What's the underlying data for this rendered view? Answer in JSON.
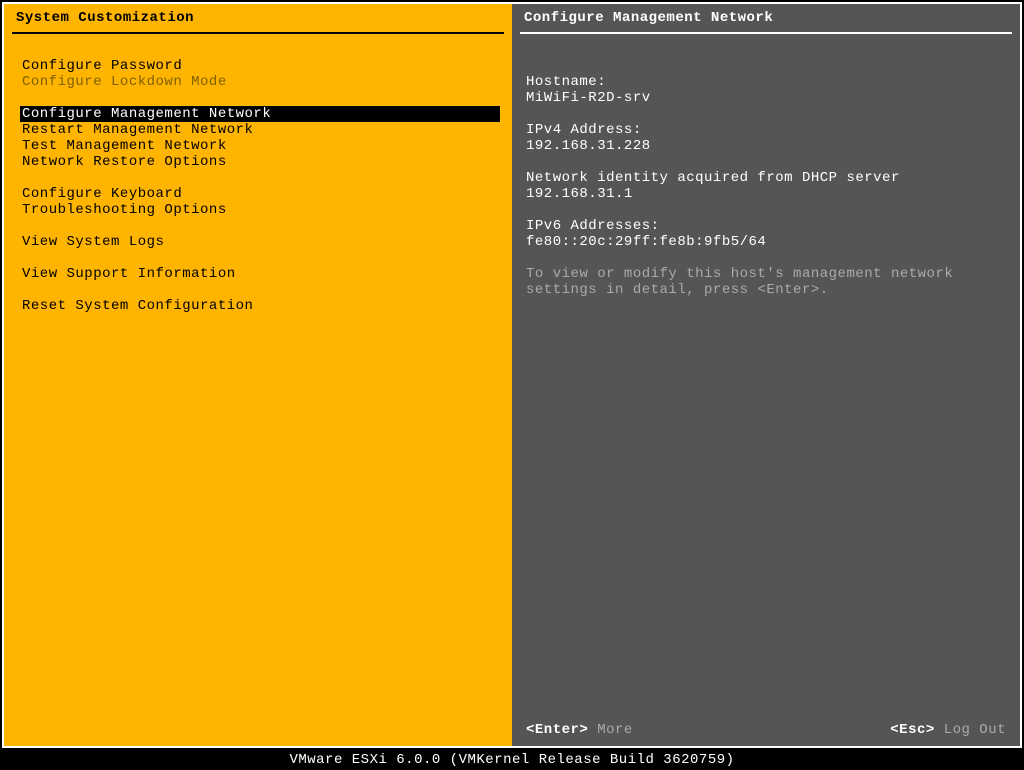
{
  "left": {
    "title": "System Customization",
    "groups": [
      [
        {
          "label": "Configure Password",
          "state": "normal"
        },
        {
          "label": "Configure Lockdown Mode",
          "state": "disabled"
        }
      ],
      [
        {
          "label": "Configure Management Network",
          "state": "selected"
        },
        {
          "label": "Restart Management Network",
          "state": "normal"
        },
        {
          "label": "Test Management Network",
          "state": "normal"
        },
        {
          "label": "Network Restore Options",
          "state": "normal"
        }
      ],
      [
        {
          "label": "Configure Keyboard",
          "state": "normal"
        },
        {
          "label": "Troubleshooting Options",
          "state": "normal"
        }
      ],
      [
        {
          "label": "View System Logs",
          "state": "normal"
        }
      ],
      [
        {
          "label": "View Support Information",
          "state": "normal"
        }
      ],
      [
        {
          "label": "Reset System Configuration",
          "state": "normal"
        }
      ]
    ]
  },
  "right": {
    "title": "Configure Management Network",
    "hostname_label": "Hostname:",
    "hostname_value": "MiWiFi-R2D-srv",
    "ipv4_label": "IPv4 Address:",
    "ipv4_value": "192.168.31.228",
    "dhcp_line": "Network identity acquired from DHCP server 192.168.31.1",
    "ipv6_label": "IPv6 Addresses:",
    "ipv6_value": "fe80::20c:29ff:fe8b:9fb5/64",
    "help_text": "To view or modify this host's management network settings in detail, press <Enter>."
  },
  "footer": {
    "enter_key": "<Enter>",
    "enter_label": "More",
    "esc_key": "<Esc>",
    "esc_label": "Log Out"
  },
  "bottom": "VMware ESXi 6.0.0 (VMKernel Release Build 3620759)"
}
